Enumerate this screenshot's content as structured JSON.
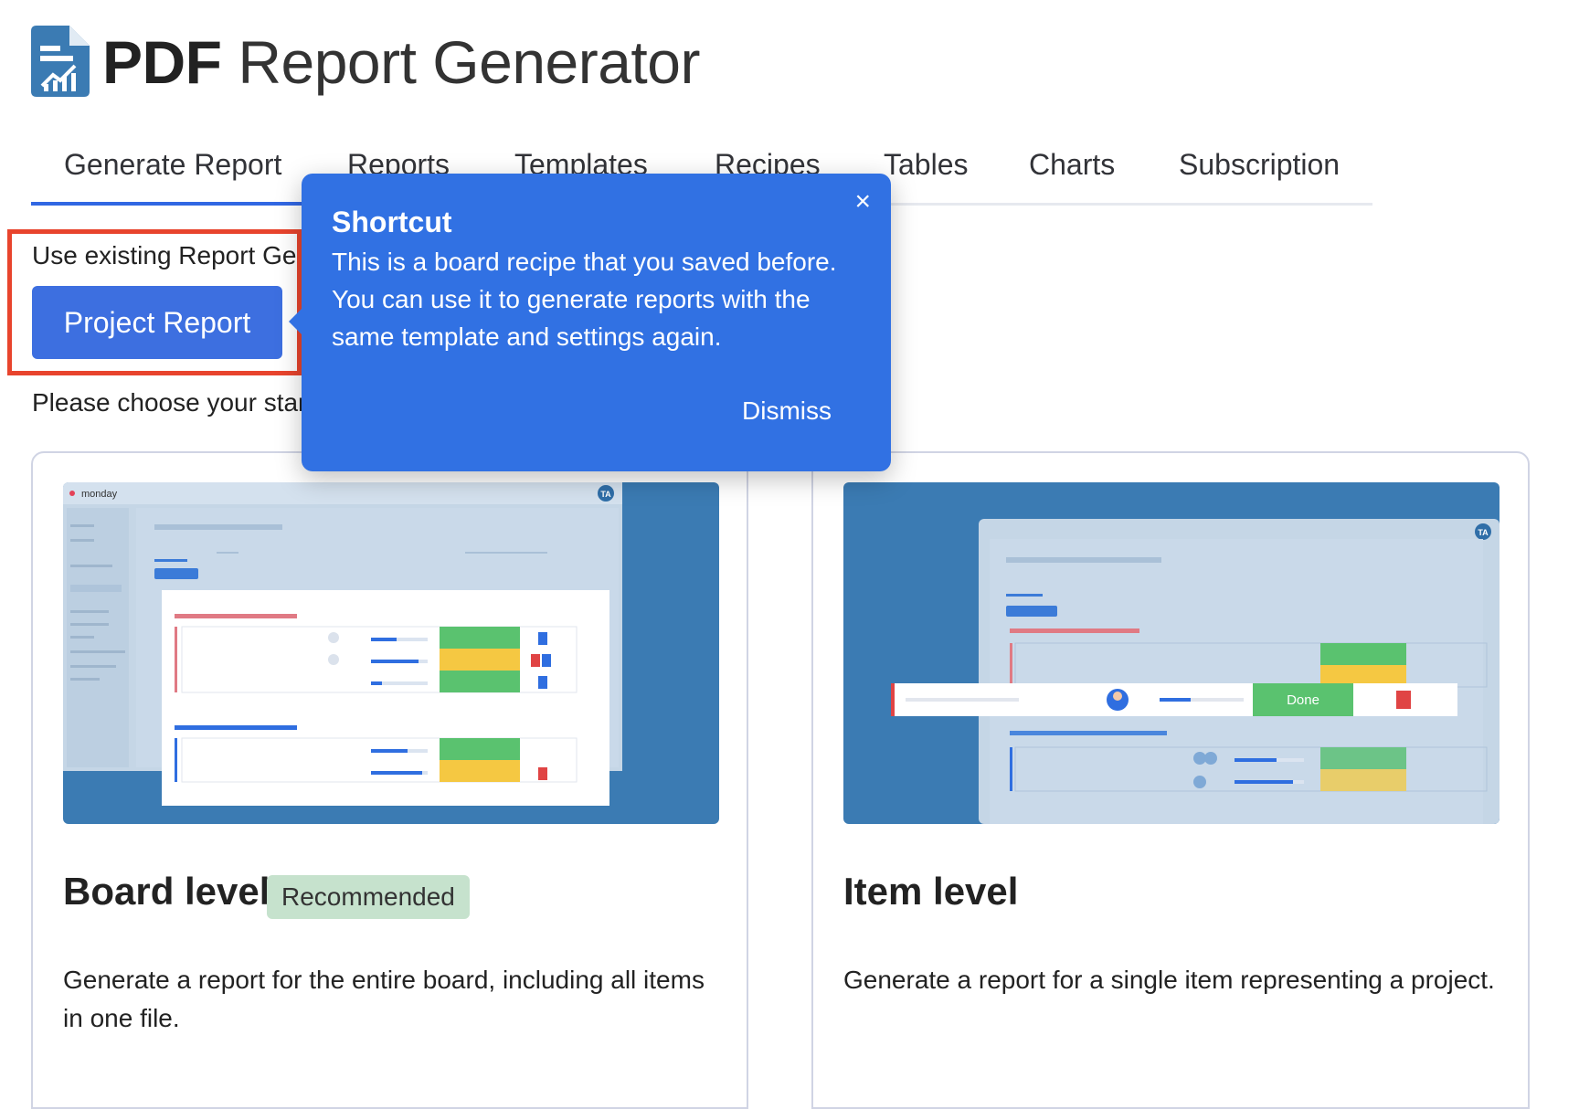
{
  "header": {
    "title_bold": "PDF",
    "title_rest": " Report Generator"
  },
  "tabs": [
    {
      "label": "Generate Report",
      "active": true
    },
    {
      "label": "Reports"
    },
    {
      "label": "Templates"
    },
    {
      "label": "Recipes"
    },
    {
      "label": "Tables"
    },
    {
      "label": "Charts"
    },
    {
      "label": "Subscription"
    }
  ],
  "existing": {
    "label": "Use existing Report Ge",
    "button": "Project Report"
  },
  "choose_label": "Please choose your star",
  "tooltip": {
    "close": "×",
    "title": "Shortcut",
    "body": "This is a board recipe that you saved before. You can use it to generate reports with the same template and settings again.",
    "dismiss": "Dismiss"
  },
  "cards": [
    {
      "title": "Board level",
      "badge": "Recommended",
      "description": "Generate a report for the entire board, including all items in one file.",
      "preview_brand": "monday",
      "preview_avatar": "TA"
    },
    {
      "title": "Item level",
      "description": "Generate a report for a single item representing a project.",
      "preview_avatar": "TA",
      "preview_status": "Done"
    }
  ],
  "colors": {
    "accent": "#3167e3",
    "tooltip": "#3171e3",
    "highlight": "#e8442d",
    "badge": "#c6e2cd",
    "status_done": "#5ac26f",
    "status_working": "#f5c842"
  }
}
